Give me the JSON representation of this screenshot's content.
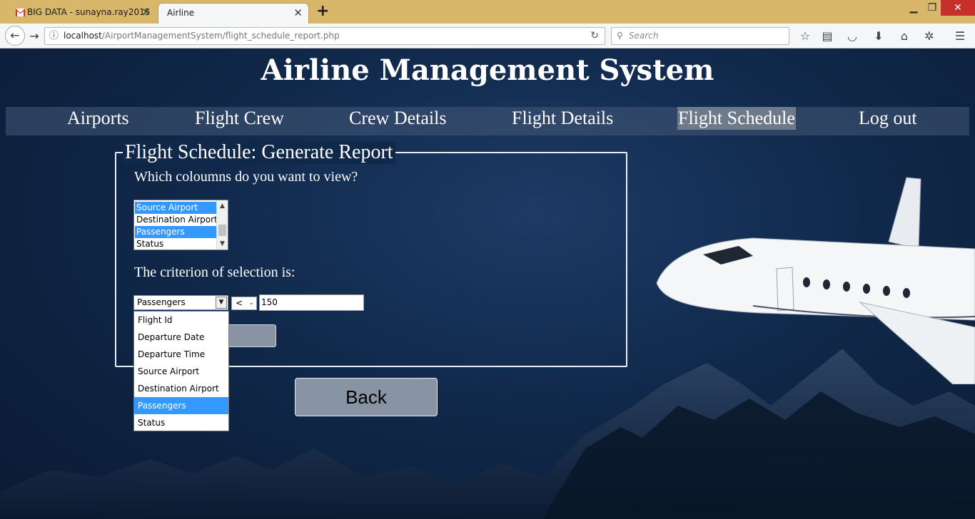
{
  "browser": {
    "tabs": [
      {
        "title": "BIG DATA - sunayna.ray2015",
        "favicon": "gmail-icon",
        "active": false
      },
      {
        "title": "Airline",
        "active": true
      }
    ],
    "url_host": "localhost",
    "url_path": "/AirportManagementSystem/flight_schedule_report.php",
    "search_placeholder": "Search"
  },
  "page": {
    "title": "Airline Management System",
    "menu": [
      {
        "label": "Airports",
        "active": false
      },
      {
        "label": "Flight Crew",
        "active": false
      },
      {
        "label": "Crew Details",
        "active": false
      },
      {
        "label": "Flight Details",
        "active": false
      },
      {
        "label": "Flight Schedule",
        "active": true
      },
      {
        "label": "Log out",
        "active": false
      }
    ],
    "form": {
      "legend": "Flight Schedule: Generate Report",
      "columns_question": "Which coloumns do you want to view?",
      "columns_visible": [
        {
          "label": "Source Airport",
          "selected": true
        },
        {
          "label": "Destination Airport",
          "selected": false
        },
        {
          "label": "Passengers",
          "selected": true
        },
        {
          "label": "Status",
          "selected": false
        }
      ],
      "criterion_label": "The criterion of selection is:",
      "criterion_field": "Passengers",
      "criterion_operator": "<",
      "criterion_value": "150",
      "field_options": [
        {
          "label": "Flight Id",
          "selected": false
        },
        {
          "label": "Departure Date",
          "selected": false
        },
        {
          "label": "Departure Time",
          "selected": false
        },
        {
          "label": "Source Airport",
          "selected": false
        },
        {
          "label": "Destination Airport",
          "selected": false
        },
        {
          "label": "Passengers",
          "selected": true
        },
        {
          "label": "Status",
          "selected": false
        }
      ]
    },
    "back_label": "Back"
  },
  "colors": {
    "tabbar": "#d8b76a",
    "selection": "#3399ff",
    "button": "#8893a4",
    "background": "#10284a"
  }
}
